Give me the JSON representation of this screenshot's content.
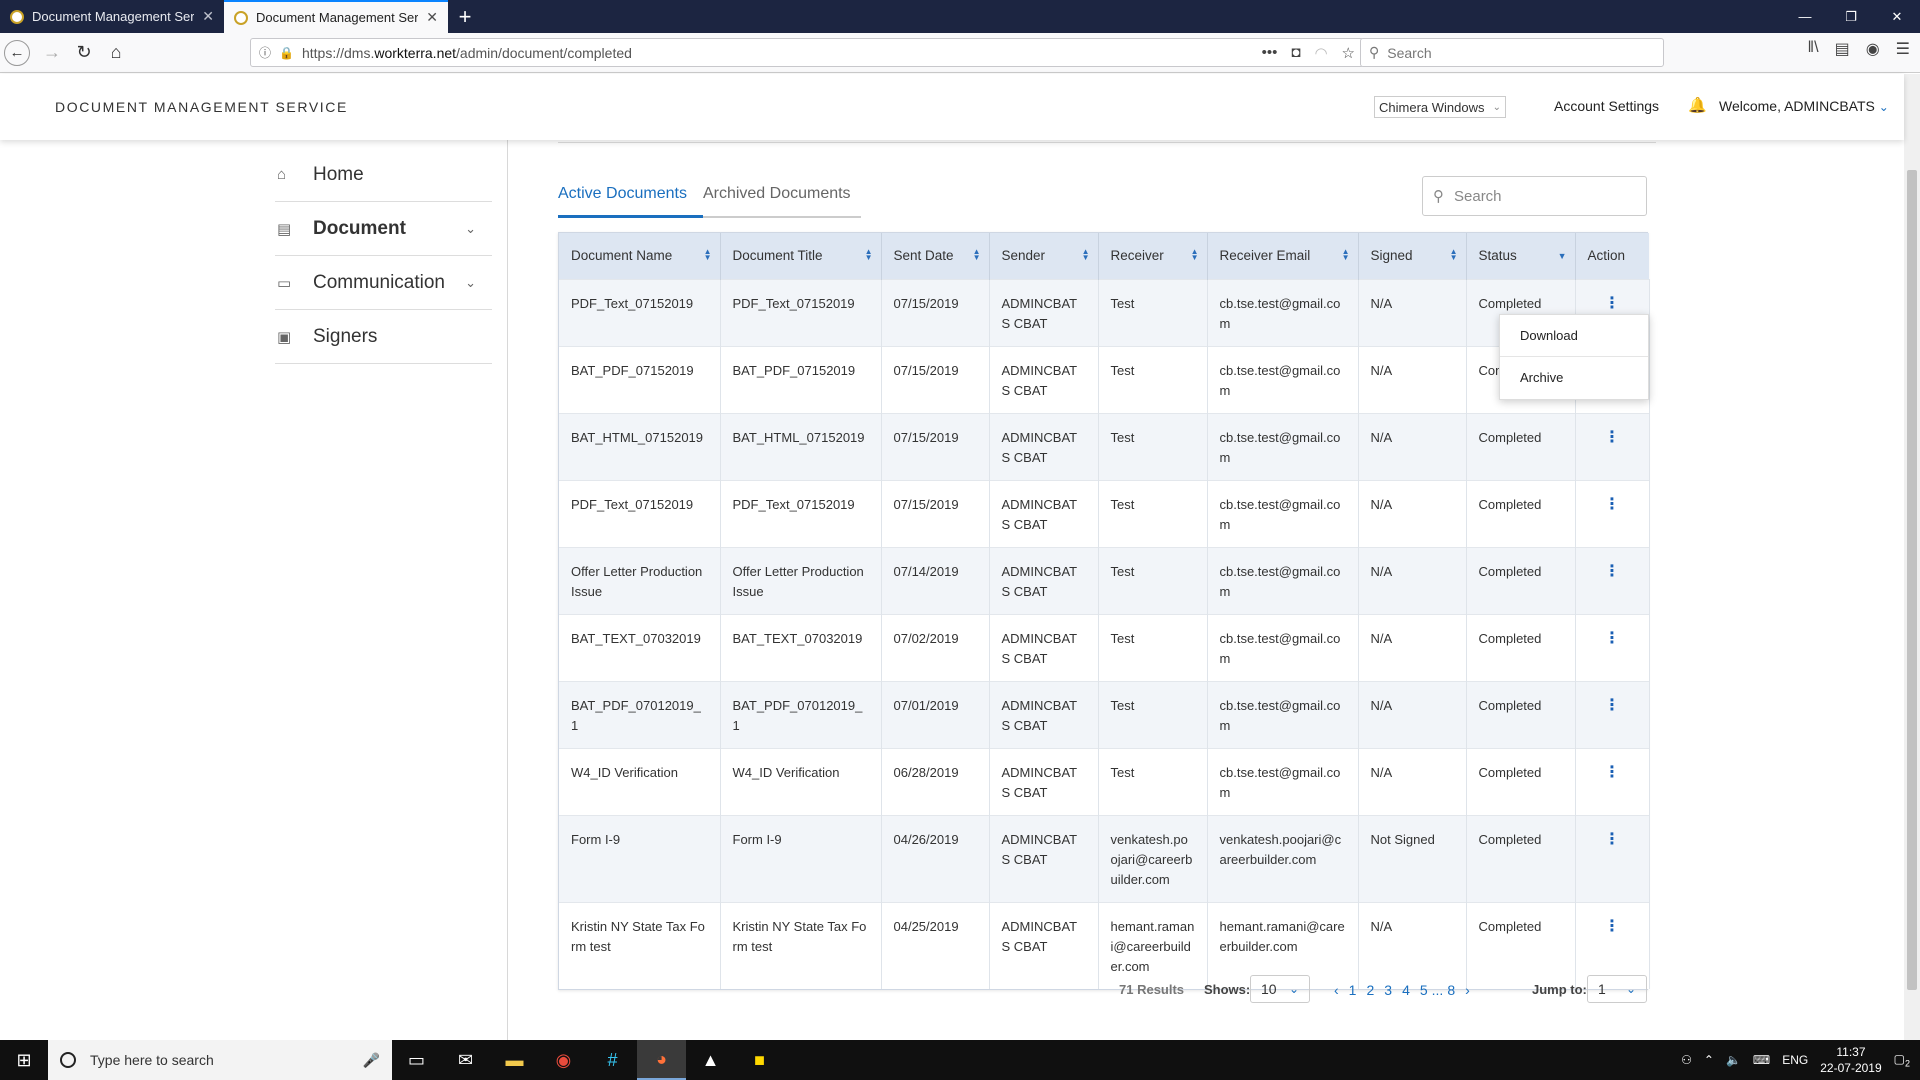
{
  "browser": {
    "tabs": [
      {
        "title": "Document Management Servic",
        "active": false
      },
      {
        "title": "Document Management Servic",
        "active": true
      }
    ],
    "url_prefix": "https://dms.",
    "url_domain": "workterra.net",
    "url_path": "/admin/document/completed",
    "search_placeholder": "Search"
  },
  "header": {
    "brand": "DOCUMENT MANAGEMENT SERVICE",
    "org_selected": "Chimera Windows",
    "account_settings": "Account Settings",
    "welcome": "Welcome, ADMINCBATS"
  },
  "sidebar": {
    "items": [
      {
        "label": "Home",
        "icon": "home-icon"
      },
      {
        "label": "Document",
        "icon": "document-icon"
      },
      {
        "label": "Communication",
        "icon": "message-icon"
      },
      {
        "label": "Signers",
        "icon": "signers-icon"
      }
    ]
  },
  "content": {
    "tab_active": "Active Documents",
    "tab_archived": "Archived Documents",
    "search_placeholder": "Search",
    "columns": [
      "Document Name",
      "Document Title",
      "Sent Date",
      "Sender",
      "Receiver",
      "Receiver Email",
      "Signed",
      "Status",
      "Action"
    ],
    "rows": [
      [
        "PDF_Text_07152019",
        "PDF_Text_07152019",
        "07/15/2019",
        "ADMINCBATS CBAT",
        "Test",
        "cb.tse.test@gmail.com",
        "N/A",
        "Completed"
      ],
      [
        "BAT_PDF_07152019",
        "BAT_PDF_07152019",
        "07/15/2019",
        "ADMINCBATS CBAT",
        "Test",
        "cb.tse.test@gmail.com",
        "N/A",
        "Completed"
      ],
      [
        "BAT_HTML_07152019",
        "BAT_HTML_07152019",
        "07/15/2019",
        "ADMINCBATS CBAT",
        "Test",
        "cb.tse.test@gmail.com",
        "N/A",
        "Completed"
      ],
      [
        "PDF_Text_07152019",
        "PDF_Text_07152019",
        "07/15/2019",
        "ADMINCBATS CBAT",
        "Test",
        "cb.tse.test@gmail.com",
        "N/A",
        "Completed"
      ],
      [
        "Offer Letter Production Issue",
        "Offer Letter Production Issue",
        "07/14/2019",
        "ADMINCBATS CBAT",
        "Test",
        "cb.tse.test@gmail.com",
        "N/A",
        "Completed"
      ],
      [
        "BAT_TEXT_07032019",
        "BAT_TEXT_07032019",
        "07/02/2019",
        "ADMINCBATS CBAT",
        "Test",
        "cb.tse.test@gmail.com",
        "N/A",
        "Completed"
      ],
      [
        "BAT_PDF_07012019_1",
        "BAT_PDF_07012019_1",
        "07/01/2019",
        "ADMINCBATS CBAT",
        "Test",
        "cb.tse.test@gmail.com",
        "N/A",
        "Completed"
      ],
      [
        "W4_ID Verification",
        "W4_ID Verification",
        "06/28/2019",
        "ADMINCBATS CBAT",
        "Test",
        "cb.tse.test@gmail.com",
        "N/A",
        "Completed"
      ],
      [
        "Form I-9",
        "Form I-9",
        "04/26/2019",
        "ADMINCBATS CBAT",
        "venkatesh.poojari@careerbuilder.com",
        "venkatesh.poojari@careerbuilder.com",
        "Not Signed",
        "Completed"
      ],
      [
        "Kristin NY State Tax Form test",
        "Kristin NY State Tax Form test",
        "04/25/2019",
        "ADMINCBATS CBAT",
        "hemant.ramani@careerbuilder.com",
        "hemant.ramani@careerbuilder.com",
        "N/A",
        "Completed"
      ]
    ],
    "action_menu": [
      "Download",
      "Archive"
    ],
    "results": "71 Results",
    "shows_label": "Shows:",
    "shows_value": "10",
    "pages": [
      "1",
      "2",
      "3",
      "4",
      "5",
      "...",
      "8"
    ],
    "jump_label": "Jump to:",
    "jump_value": "1"
  },
  "taskbar": {
    "search_placeholder": "Type here to search",
    "lang": "ENG",
    "time": "11:37",
    "date": "22-07-2019",
    "notifications": "2"
  }
}
